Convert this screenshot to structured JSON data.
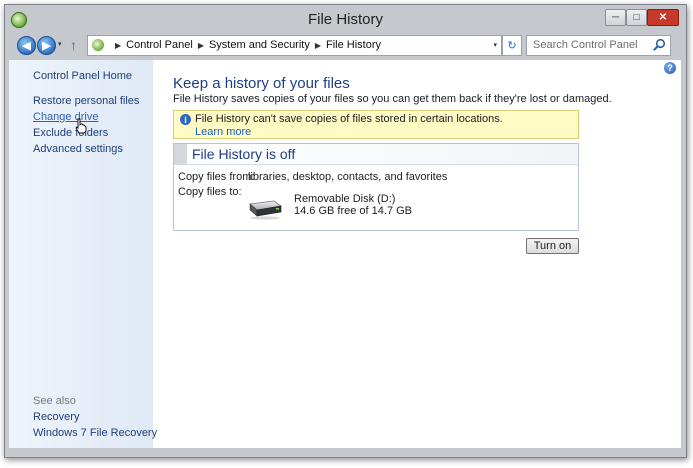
{
  "window": {
    "title": "File History",
    "buttons": {
      "minimize": "─",
      "maximize": "□",
      "close": "✕"
    }
  },
  "navigation": {
    "back_glyph": "◀",
    "forward_glyph": "▶",
    "recent_glyph": "▾",
    "up_glyph": "↑",
    "breadcrumb": [
      "Control Panel",
      "System and Security",
      "File History"
    ],
    "separator": "▶",
    "address_dropdown": "▾",
    "refresh_glyph": "↻",
    "search_placeholder": "Search Control Panel"
  },
  "sidebar": {
    "home": "Control Panel Home",
    "links": [
      "Restore personal files",
      "Change drive",
      "Exclude folders",
      "Advanced settings"
    ],
    "hovered_link": "Change drive",
    "see_also_label": "See also",
    "see_also_links": [
      "Recovery",
      "Windows 7 File Recovery"
    ]
  },
  "main": {
    "help_glyph": "?",
    "title": "Keep a history of your files",
    "description": "File History saves copies of your files so you can get them back if they're lost or damaged.",
    "info": {
      "icon": "i",
      "text": "File History can't save copies of files stored in certain locations.",
      "link": "Learn more"
    },
    "status_panel": {
      "title": "File History is off",
      "copy_from_label": "Copy files from:",
      "copy_from_value": "libraries, desktop, contacts, and favorites",
      "copy_to_label": "Copy files to:",
      "drive_name": "Removable Disk (D:)",
      "drive_free": "14.6 GB free of 14.7 GB"
    },
    "turn_on_button": "Turn on"
  },
  "icons": {
    "app": "file-history-icon",
    "search": "search-icon",
    "drive": "removable-drive-icon",
    "info": "info-icon",
    "help": "help-icon",
    "cursor": "hand-cursor-icon"
  },
  "colors": {
    "link": "#1d3f79",
    "title": "#1e3e87",
    "infobar_bg": "#fefbc5",
    "close_button": "#c7392a"
  }
}
